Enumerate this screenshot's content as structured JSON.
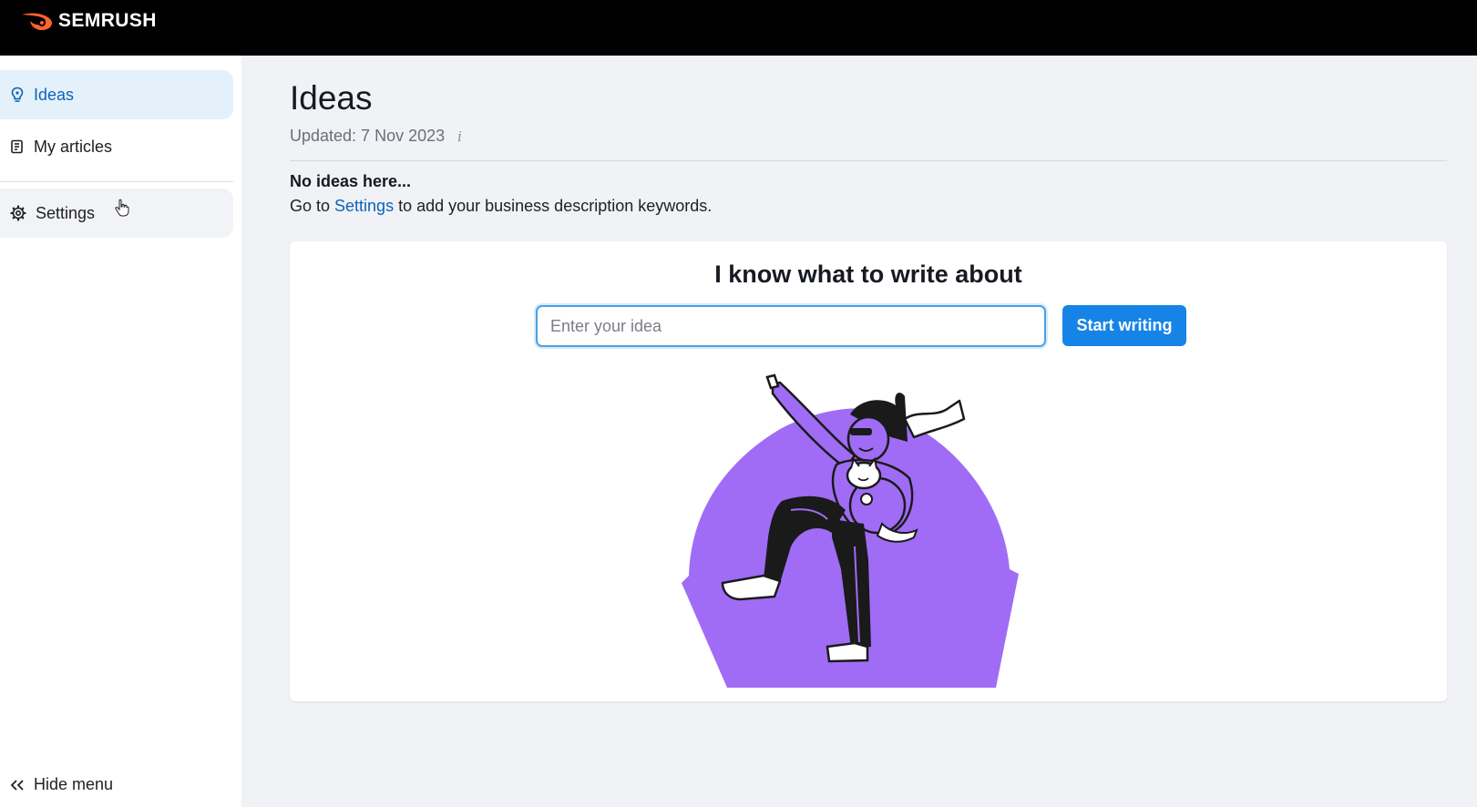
{
  "brand": {
    "name": "SEMRUSH",
    "accent": "#ff642d"
  },
  "sidebar": {
    "items": [
      {
        "label": "Ideas",
        "icon": "lightbulb-icon",
        "active": true
      },
      {
        "label": "My articles",
        "icon": "document-icon",
        "active": false
      },
      {
        "label": "Settings",
        "icon": "gear-icon",
        "active": false
      }
    ],
    "hide_menu_label": "Hide menu"
  },
  "main": {
    "title": "Ideas",
    "updated": "Updated: 7 Nov 2023",
    "info_icon": "i",
    "empty_title": "No ideas here...",
    "empty_prefix": "Go to ",
    "empty_link": "Settings",
    "empty_suffix": " to add your business description keywords."
  },
  "writer": {
    "title": "I know what to write about",
    "input_placeholder": "Enter your idea",
    "input_value": "",
    "button_label": "Start writing"
  },
  "colors": {
    "primary": "#1584e6",
    "link": "#0e63b8",
    "illustration_purple": "#a06cf6"
  }
}
